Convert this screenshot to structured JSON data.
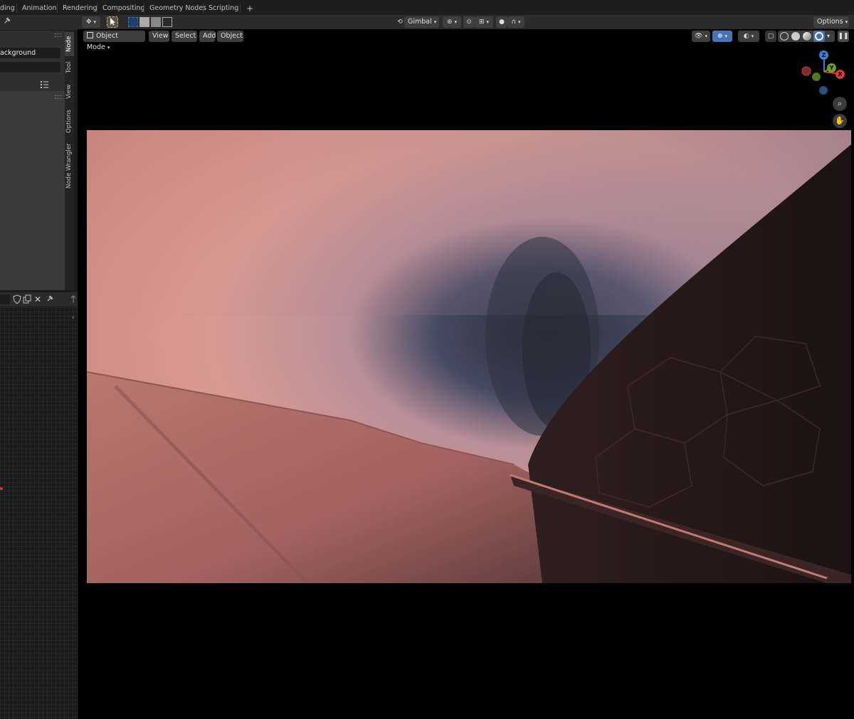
{
  "workspace_tabs": [
    "ding",
    "Animation",
    "Rendering",
    "Compositing",
    "Geometry Nodes",
    "Scripting"
  ],
  "add_tab_label": "+",
  "left_panel": {
    "field1_value": "ackground",
    "side_tabs": [
      "Node",
      "Tool",
      "View",
      "Options",
      "Node Wrangler"
    ]
  },
  "viewport": {
    "mode_label": "Object Mode",
    "menus": [
      "View",
      "Select",
      "Add",
      "Object"
    ],
    "transform_orientation": "Gimbal",
    "options_label": "Options",
    "gizmo": {
      "z": "Z",
      "y": "Y",
      "x": "X"
    }
  },
  "colors": {
    "accent": "#4772b3",
    "x_axis": "#d43b3b",
    "y_axis": "#6ea12b",
    "z_axis": "#3d7fd6",
    "active_tool": "#f0a63a"
  }
}
